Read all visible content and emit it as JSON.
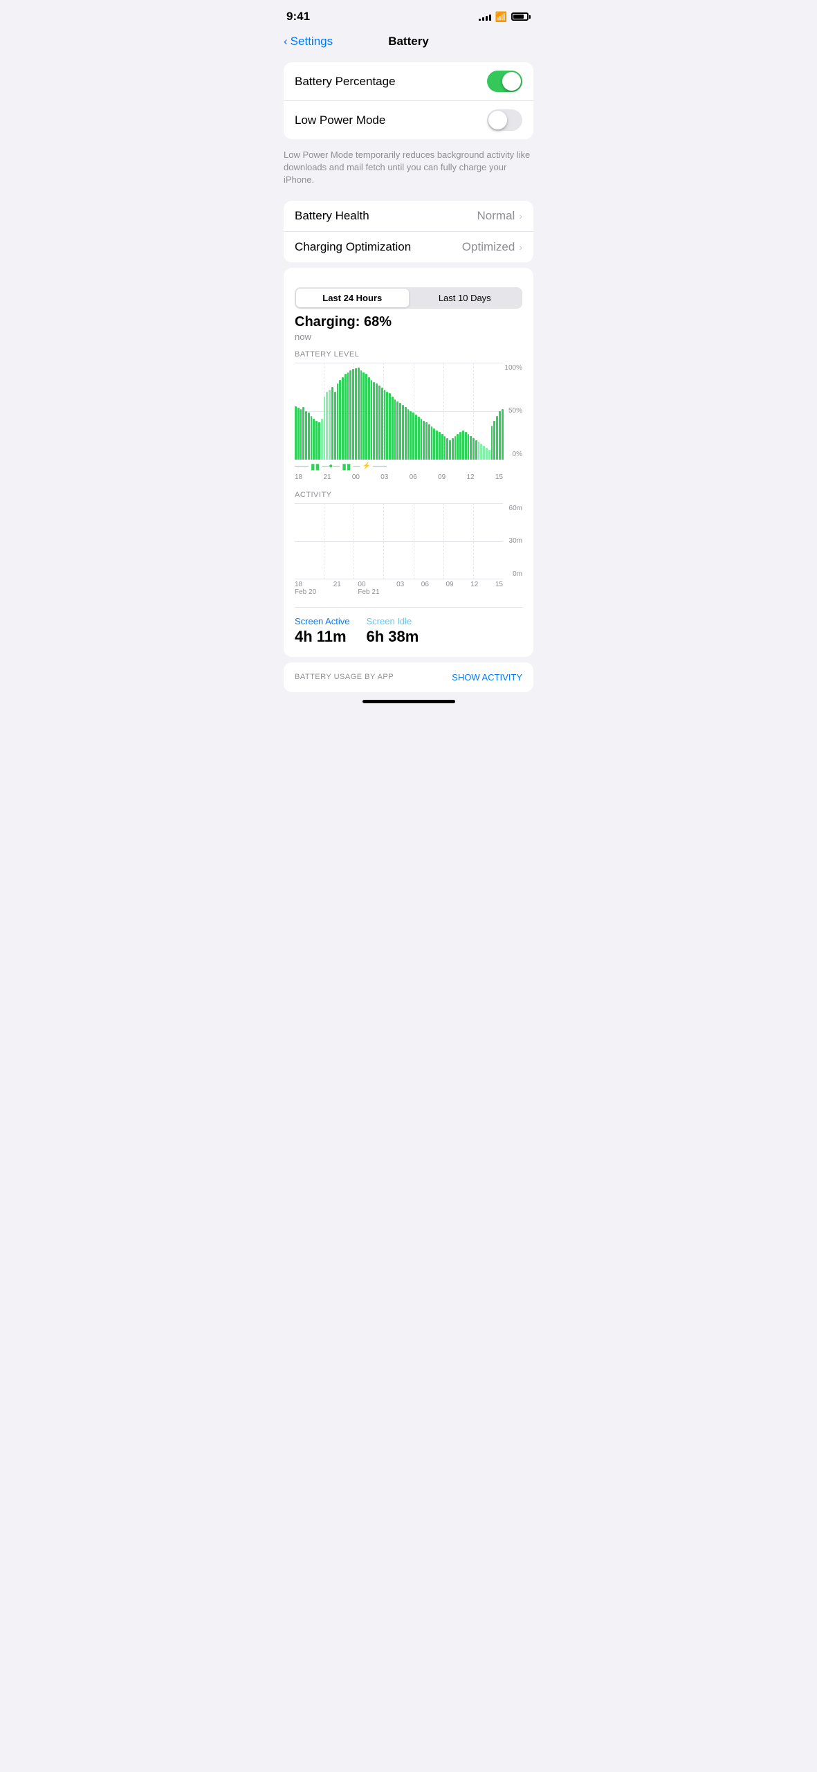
{
  "statusBar": {
    "time": "9:41"
  },
  "nav": {
    "backLabel": "Settings",
    "title": "Battery"
  },
  "settings": {
    "batteryPercentage": {
      "label": "Battery Percentage",
      "enabled": true
    },
    "lowPowerMode": {
      "label": "Low Power Mode",
      "enabled": false,
      "description": "Low Power Mode temporarily reduces background activity like downloads and mail fetch until you can fully charge your iPhone."
    },
    "batteryHealth": {
      "label": "Battery Health",
      "value": "Normal"
    },
    "chargingOptimization": {
      "label": "Charging Optimization",
      "value": "Optimized"
    }
  },
  "chart": {
    "segment": {
      "option1": "Last 24 Hours",
      "option2": "Last 10 Days",
      "active": 0
    },
    "chargingStatus": "Charging: 68%",
    "chargingTime": "now",
    "batteryLevelLabel": "BATTERY LEVEL",
    "activityLabel": "ACTIVITY",
    "xLabels": [
      "18",
      "21",
      "00",
      "03",
      "06",
      "09",
      "12",
      "15"
    ],
    "yLabels": [
      "100%",
      "50%",
      "0%"
    ],
    "actYLabels": [
      "60m",
      "30m",
      "0m"
    ],
    "dateLabels": [
      {
        "line1": "18",
        "line2": "Feb 20"
      },
      {
        "line1": "21",
        "line2": ""
      },
      {
        "line1": "00",
        "line2": "Feb 21"
      },
      {
        "line1": "03",
        "line2": ""
      },
      {
        "line1": "06",
        "line2": ""
      },
      {
        "line1": "09",
        "line2": ""
      },
      {
        "line1": "12",
        "line2": ""
      },
      {
        "line1": "15",
        "line2": ""
      }
    ],
    "screenActive": {
      "label": "Screen Active",
      "value": "4h 11m"
    },
    "screenIdle": {
      "label": "Screen Idle",
      "value": "6h 38m"
    },
    "batteryUsageLabel": "BATTERY USAGE BY APP",
    "showActivityLabel": "SHOW ACTIVITY"
  }
}
